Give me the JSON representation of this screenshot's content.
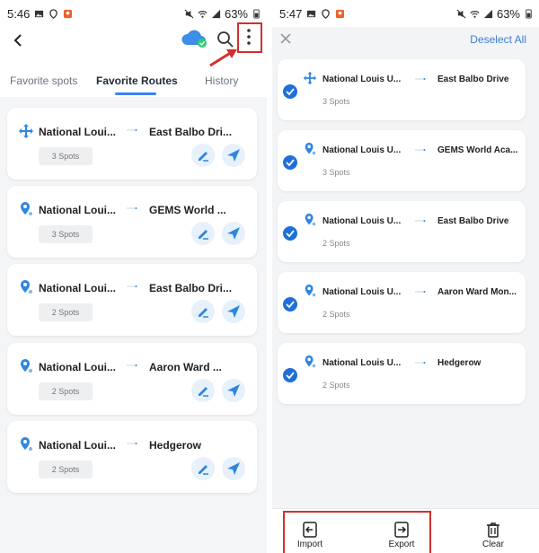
{
  "left": {
    "status": {
      "time": "5:46",
      "battery": "63%"
    },
    "tabs": [
      "Favorite spots",
      "Favorite Routes",
      "History"
    ],
    "active_tab": "Favorite Routes",
    "routes": [
      {
        "from": "National Loui...",
        "to": "East Balbo Dri...",
        "spots": "3 Spots",
        "pin": "move-icon"
      },
      {
        "from": "National Loui...",
        "to": "GEMS World ...",
        "spots": "3 Spots",
        "pin": "location-pin-icon"
      },
      {
        "from": "National Loui...",
        "to": "East Balbo Dri...",
        "spots": "2 Spots",
        "pin": "location-pin-icon"
      },
      {
        "from": "National Loui...",
        "to": "Aaron Ward ...",
        "spots": "2 Spots",
        "pin": "location-pin-icon"
      },
      {
        "from": "National Loui...",
        "to": "Hedgerow",
        "spots": "2 Spots",
        "pin": "location-pin-icon"
      }
    ]
  },
  "right": {
    "status": {
      "time": "5:47",
      "battery": "63%"
    },
    "deselect_label": "Deselect All",
    "routes": [
      {
        "from": "National Louis U...",
        "to": "East Balbo Drive",
        "spots": "3 Spots",
        "pin": "move-icon"
      },
      {
        "from": "National Louis U...",
        "to": "GEMS World Aca...",
        "spots": "3 Spots",
        "pin": "location-pin-icon"
      },
      {
        "from": "National Louis U...",
        "to": "East Balbo Drive",
        "spots": "2 Spots",
        "pin": "location-pin-icon"
      },
      {
        "from": "National Louis U...",
        "to": "Aaron Ward Mon...",
        "spots": "2 Spots",
        "pin": "location-pin-icon"
      },
      {
        "from": "National Louis U...",
        "to": "Hedgerow",
        "spots": "2 Spots",
        "pin": "location-pin-icon"
      }
    ],
    "bottom": {
      "import_label": "Import",
      "export_label": "Export",
      "clear_label": "Clear"
    }
  },
  "colors": {
    "accent": "#1e6fd9",
    "highlight": "#d32f2f"
  }
}
